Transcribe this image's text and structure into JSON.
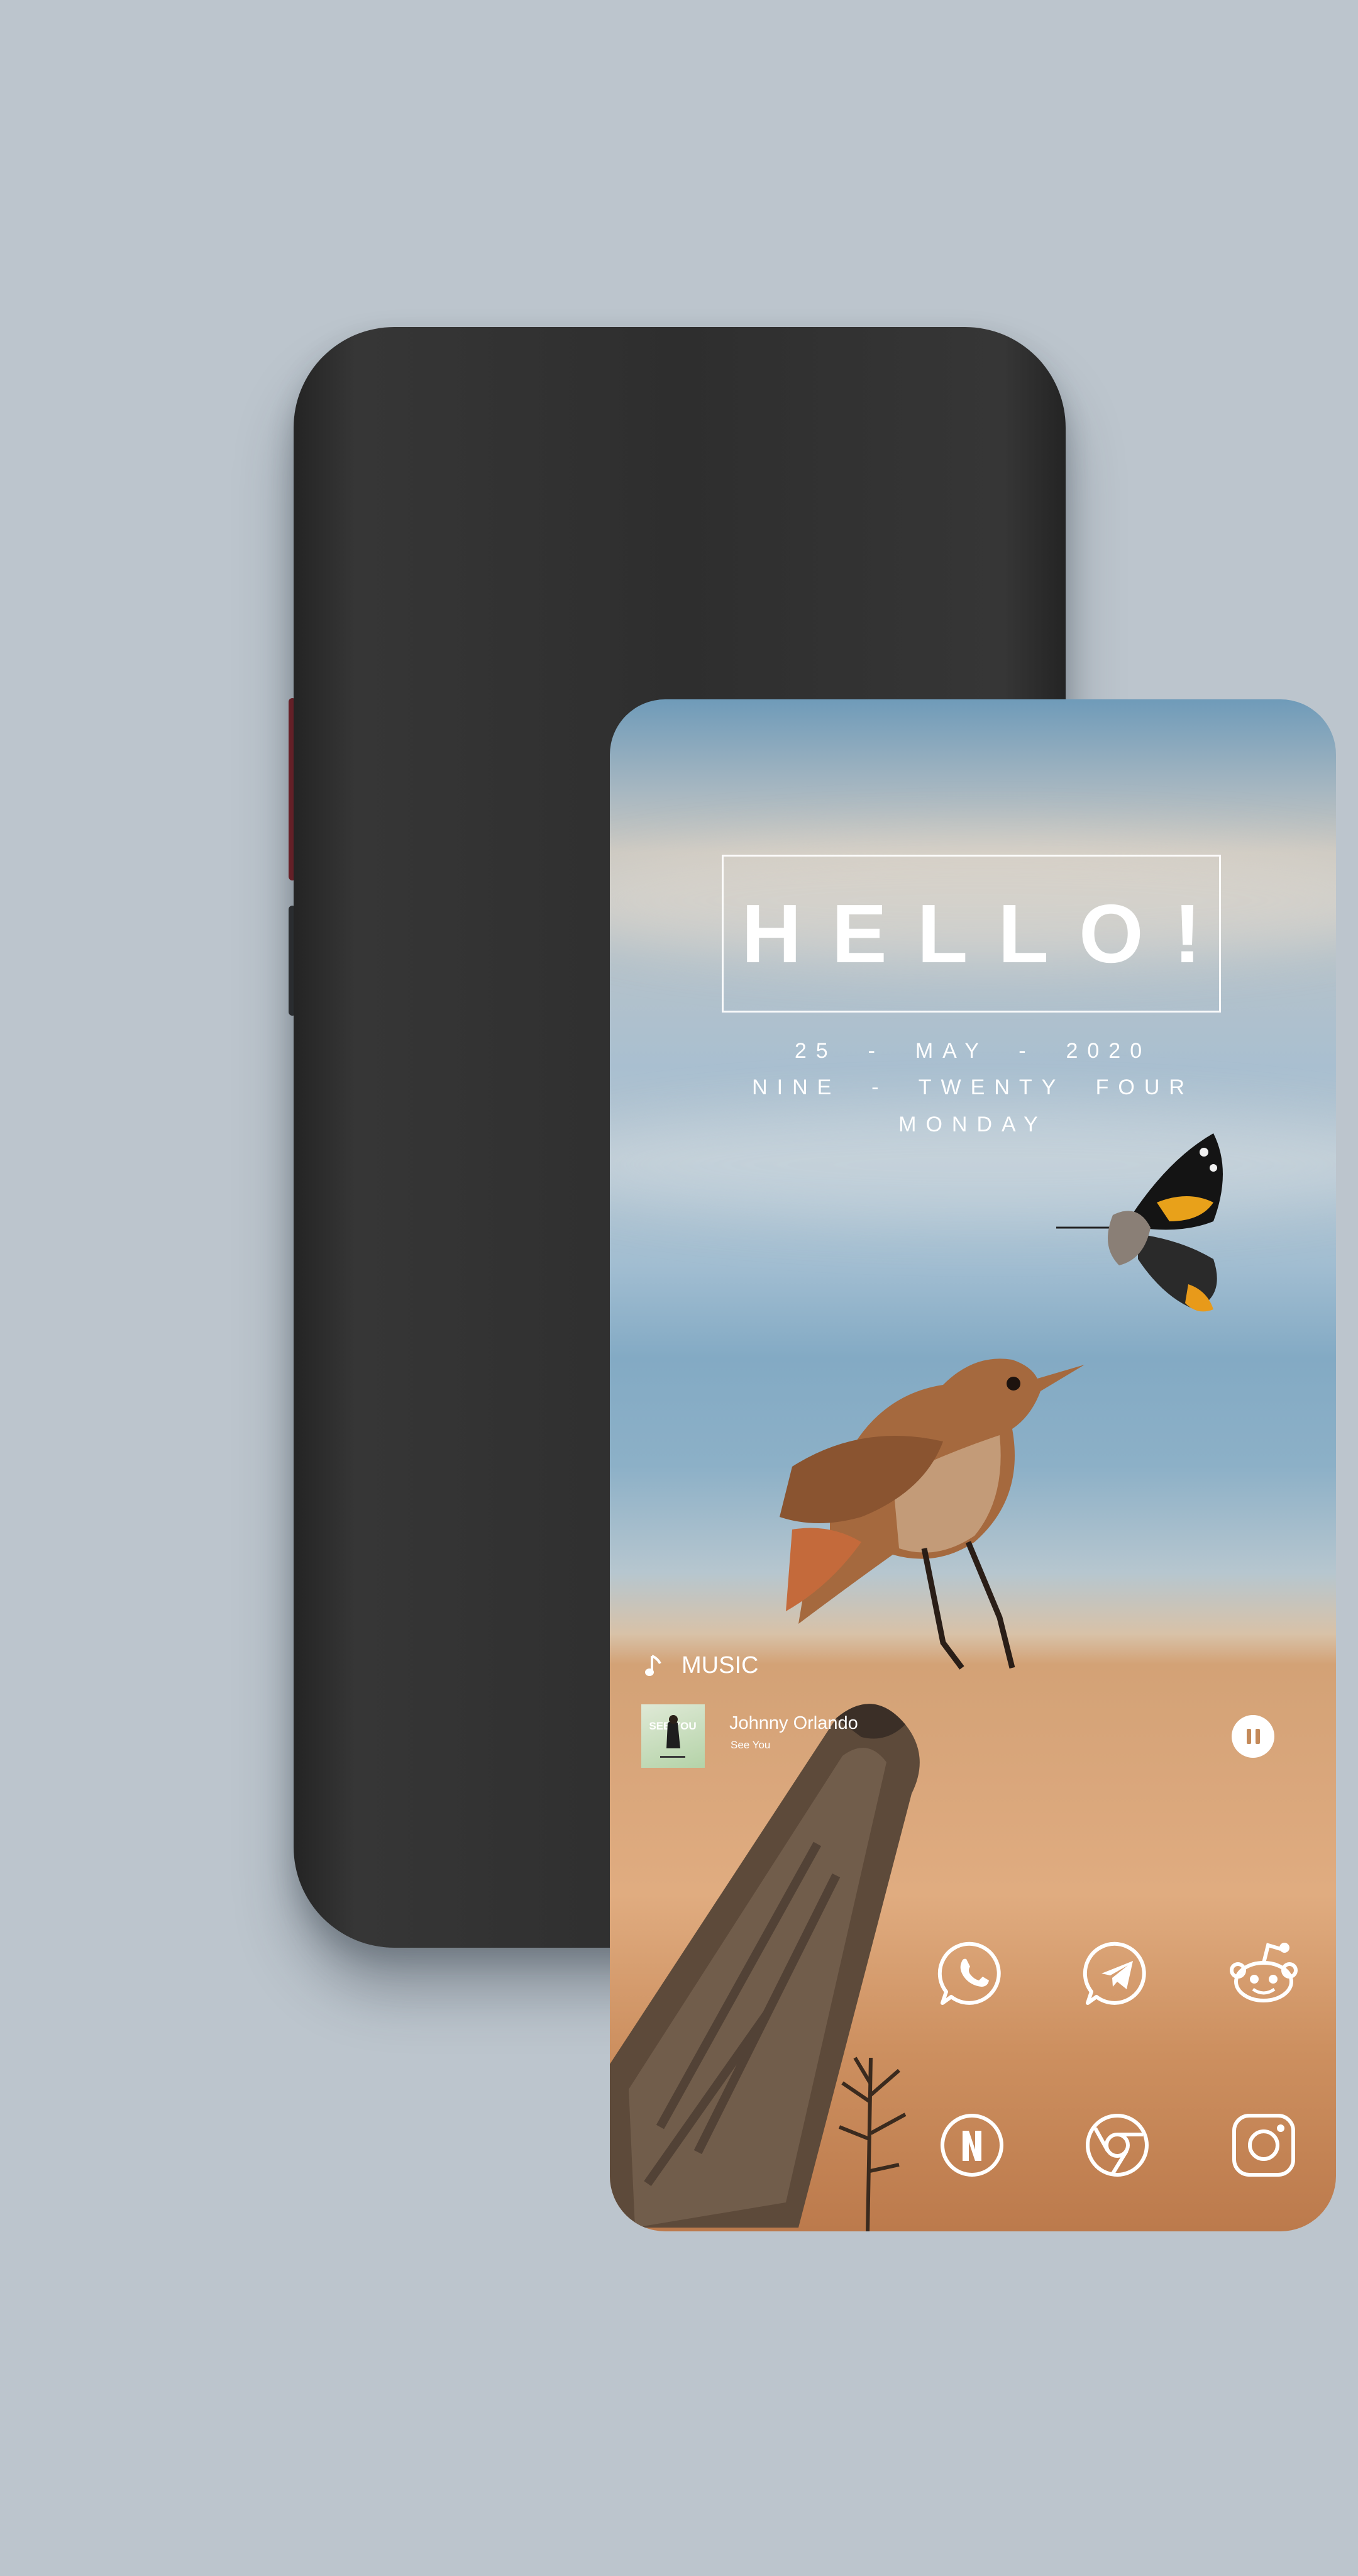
{
  "clock_widget": {
    "greeting": "HELLO!",
    "date": "25  -  MAY  -  2020",
    "time_words": "NINE  -  TWENTY  FOUR",
    "weekday": "MONDAY"
  },
  "music_widget": {
    "header": "MUSIC",
    "track_title": "Johnny Orlando",
    "track_subtitle": "See You",
    "album_art_text": "SEE YOU"
  },
  "dock_apps": [
    {
      "name": "WhatsApp",
      "icon": "whatsapp-icon"
    },
    {
      "name": "Telegram",
      "icon": "telegram-icon"
    },
    {
      "name": "Reddit",
      "icon": "reddit-icon"
    },
    {
      "name": "Netflix",
      "icon": "netflix-icon"
    },
    {
      "name": "Chrome",
      "icon": "chrome-icon"
    },
    {
      "name": "Instagram",
      "icon": "instagram-icon"
    }
  ],
  "colors": {
    "background": "#bcc5cd",
    "phone_frame": "#2e2e2e",
    "side_button_accent": "#7a1c22",
    "widget_text": "#ffffff"
  }
}
